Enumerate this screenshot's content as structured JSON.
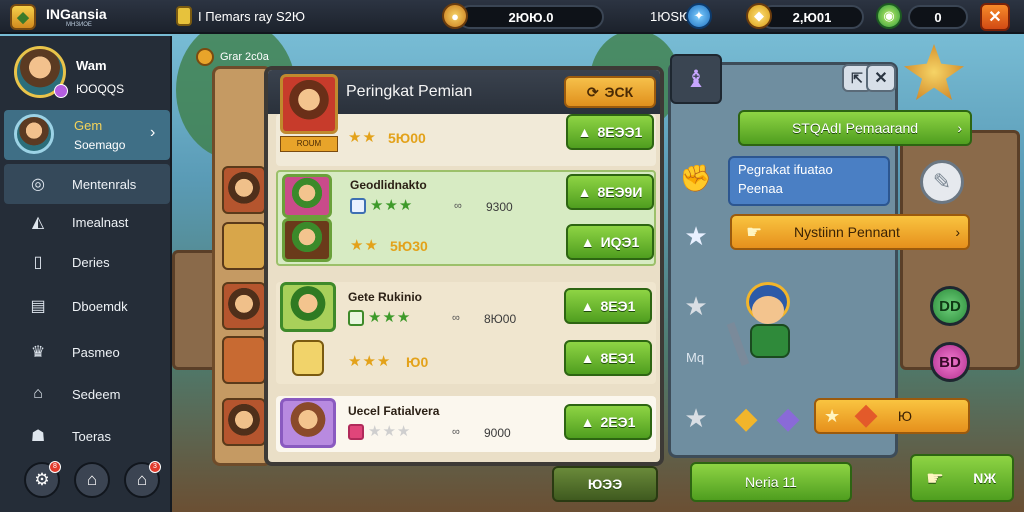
{
  "topbar": {
    "app_title": "INGansia",
    "app_subtitle": "МНЗИОЕ",
    "quest_text": "I Пemars ray S2Ю",
    "gold_value": "2ЮЮ.0",
    "mid_text": "1ЮSЮ",
    "gem_value": "2,Ю01",
    "counter_value": "0"
  },
  "sidebar": {
    "profile": {
      "name": "Wam",
      "sub": "ЮOQQS"
    },
    "items": [
      {
        "label": "Gem",
        "sub": "Soemago",
        "icon": "character-icon"
      },
      {
        "label": "Mentenrals",
        "icon": "target-icon"
      },
      {
        "label": "Imealnast",
        "icon": "map-icon"
      },
      {
        "label": "Deries",
        "icon": "book-icon"
      },
      {
        "label": "Dboemdk",
        "icon": "chest-icon"
      },
      {
        "label": "Pasmeo",
        "icon": "trophy-icon"
      },
      {
        "label": "Sedeem",
        "icon": "house-icon"
      },
      {
        "label": "Toeras",
        "icon": "people-icon"
      }
    ],
    "footer_badges": [
      "8",
      "",
      "3"
    ]
  },
  "back_header": "Grar 2c0a",
  "leaderboard": {
    "title": "Peringkat Pemian",
    "head_button": "ЭCК",
    "rows": [
      {
        "name": "",
        "score": "",
        "gold": "5Ю00",
        "button": "8ЕЭЭ1",
        "rank_label": "ROUM"
      },
      {
        "name": "Geodlidnakto",
        "score": "9300",
        "gold": "",
        "button": "8ЕЭ9И",
        "stars": "★★★"
      },
      {
        "name": "",
        "score": "",
        "gold": "5Ю30",
        "button": "ИQЭ1"
      },
      {
        "name": "Gete Rukinio",
        "score": "8Ю00",
        "gold": "",
        "button": "8ЕЭ1"
      },
      {
        "name": "",
        "score": "",
        "gold": "Ю0",
        "button": "8ЕЭ1"
      },
      {
        "name": "Uecel Fatialvera",
        "score": "9000",
        "gold": "",
        "button": "2ЕЭ1"
      }
    ],
    "bottom_button": "ЮЭЭ"
  },
  "right_panel": {
    "top_button": "STQAdI Pemaarand",
    "info_title": "Pegrakat ifuatao",
    "info_sub": "Peenaa",
    "orange_button": "Nystiinn Pennant",
    "side_label": "Mq",
    "bottom_button_suffix": "Ю",
    "bottom_green": "Neria 11",
    "circle_a": "DD",
    "circle_b": "BD",
    "corner_button": "NЖ"
  },
  "colors": {
    "accent_green": "#4f9e1f",
    "accent_orange": "#e6901c",
    "panel_dark": "#2a313b",
    "panel_cream": "#eadfc7"
  }
}
